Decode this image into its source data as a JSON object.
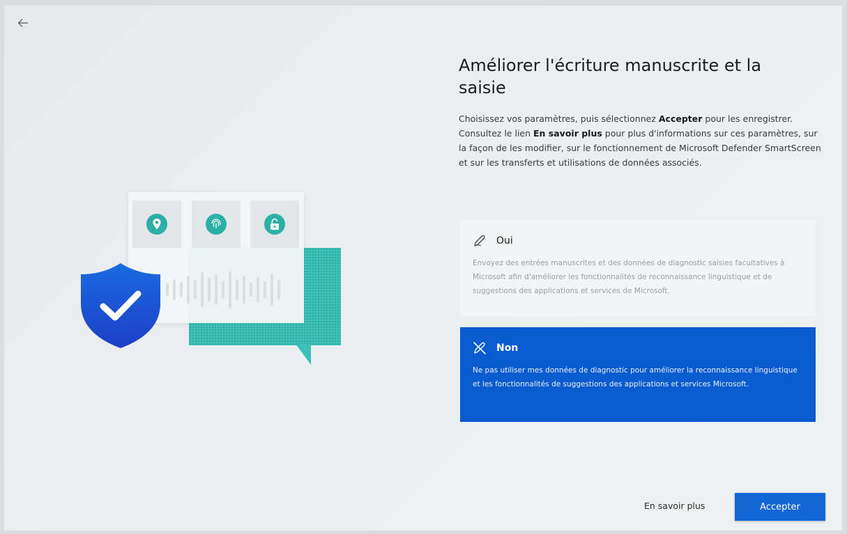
{
  "nav": {
    "back_icon": "arrow-left-icon"
  },
  "page": {
    "title": "Améliorer l'écriture manuscrite et la saisie",
    "desc_part1": "Choisissez vos paramètres, puis sélectionnez ",
    "desc_bold1": "Accepter",
    "desc_part2": " pour les enregistrer. Consultez le lien ",
    "desc_bold2": "En savoir plus",
    "desc_part3": " pour plus d'informations sur ces paramètres, sur la façon de les modifier, sur le fonctionnement de Microsoft Defender SmartScreen et sur les transferts et utilisations de données associés."
  },
  "options": {
    "yes": {
      "icon": "pen-icon",
      "title": "Oui",
      "text": "Envoyez des entrées manuscrites et des données de diagnostic saisies facultatives à Microsoft afin d'améliorer les fonctionnalités de reconnaissance linguistique et de suggestions des applications et services de Microsoft."
    },
    "no": {
      "icon": "pen-off-icon",
      "title": "Non",
      "text": "Ne pas utiliser mes données de diagnostic pour améliorer la reconnaissance linguistique et les fonctionnalités de suggestions des applications et services Microsoft."
    }
  },
  "footer": {
    "learn_more": "En savoir plus",
    "accept": "Accepter"
  },
  "colors": {
    "selected": "#0a5bd0",
    "accent": "#1266d6",
    "teal": "#2bb0a6"
  }
}
